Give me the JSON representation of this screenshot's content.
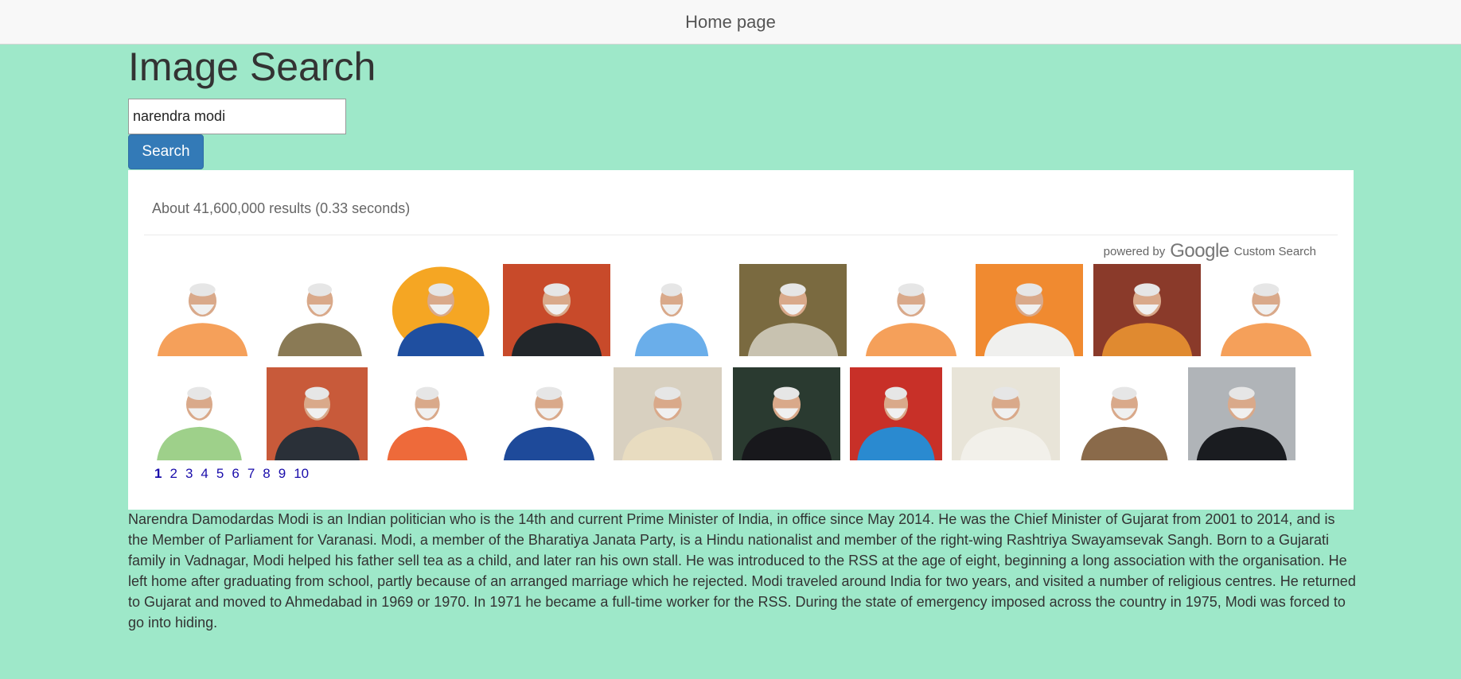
{
  "nav": {
    "home_label": "Home page"
  },
  "page": {
    "title": "Image Search"
  },
  "search": {
    "value": "narendra modi",
    "button_label": "Search"
  },
  "results": {
    "stats": "About 41,600,000 results (0.33 seconds)",
    "powered_by": "powered by",
    "google_logo": "Google",
    "custom_search": "Custom Search"
  },
  "images": [
    {
      "bg": "#ffffff",
      "shirt": "#f5a05a"
    },
    {
      "bg": "#ffffff",
      "shirt": "#8a7a55"
    },
    {
      "bg": "#f5a623",
      "shirt": "#1f4fa0",
      "circle": true
    },
    {
      "bg": "#c84a2a",
      "shirt": "#22262a"
    },
    {
      "bg": "#ffffff",
      "shirt": "#6aaeea"
    },
    {
      "bg": "#7a6a40",
      "shirt": "#c8c2b0"
    },
    {
      "bg": "#ffffff",
      "shirt": "#f5a05a"
    },
    {
      "bg": "#f08a30",
      "shirt": "#f0f0ee"
    },
    {
      "bg": "#8a3a2a",
      "shirt": "#e08a30"
    },
    {
      "bg": "#ffffff",
      "shirt": "#f5a05a"
    },
    {
      "bg": "#ffffff",
      "shirt": "#9ed08a"
    },
    {
      "bg": "#c85a3a",
      "shirt": "#2a3038"
    },
    {
      "bg": "#ffffff",
      "shirt": "#ee6a3a"
    },
    {
      "bg": "#ffffff",
      "shirt": "#1e4a9a"
    },
    {
      "bg": "#d8d0c0",
      "shirt": "#e8dcc0"
    },
    {
      "bg": "#2a3a30",
      "shirt": "#18181c"
    },
    {
      "bg": "#c83028",
      "shirt": "#2a8ad0"
    },
    {
      "bg": "#e8e4d8",
      "shirt": "#f2f0ea"
    },
    {
      "bg": "#ffffff",
      "shirt": "#8a6a4a"
    },
    {
      "bg": "#b0b4b8",
      "shirt": "#1a1c20"
    }
  ],
  "pagination": [
    "1",
    "2",
    "3",
    "4",
    "5",
    "6",
    "7",
    "8",
    "9",
    "10"
  ],
  "description": "Narendra Damodardas Modi is an Indian politician who is the 14th and current Prime Minister of India, in office since May 2014. He was the Chief Minister of Gujarat from 2001 to 2014, and is the Member of Parliament for Varanasi. Modi, a member of the Bharatiya Janata Party, is a Hindu nationalist and member of the right-wing Rashtriya Swayamsevak Sangh. Born to a Gujarati family in Vadnagar, Modi helped his father sell tea as a child, and later ran his own stall. He was introduced to the RSS at the age of eight, beginning a long association with the organisation. He left home after graduating from school, partly because of an arranged marriage which he rejected. Modi traveled around India for two years, and visited a number of religious centres. He returned to Gujarat and moved to Ahmedabad in 1969 or 1970. In 1971 he became a full-time worker for the RSS. During the state of emergency imposed across the country in 1975, Modi was forced to go into hiding."
}
